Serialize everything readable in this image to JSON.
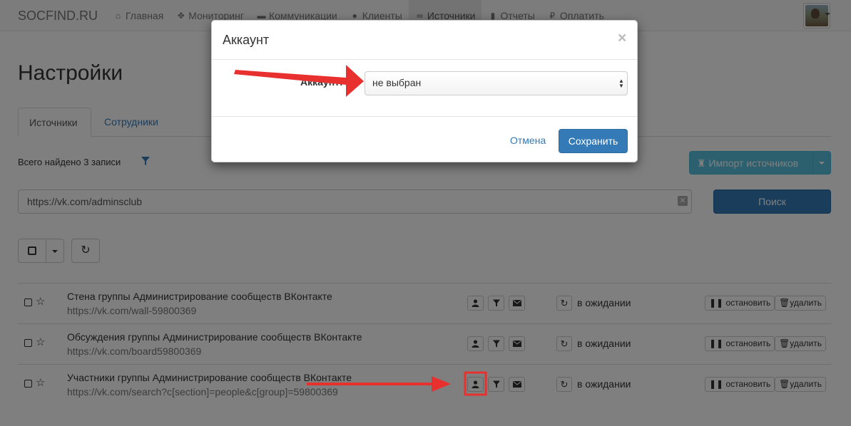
{
  "navbar": {
    "brand": "SOCFIND.RU",
    "items": [
      {
        "label": "Главная",
        "icon": "home-icon",
        "glyph": "⌂"
      },
      {
        "label": "Мониторинг",
        "icon": "move-icon",
        "glyph": "✥"
      },
      {
        "label": "Коммуникации",
        "icon": "comment-icon",
        "glyph": "▬"
      },
      {
        "label": "Клиенты",
        "icon": "user-icon",
        "glyph": "●"
      },
      {
        "label": "Источники",
        "icon": "link-icon",
        "glyph": "∞"
      },
      {
        "label": "Отчеты",
        "icon": "stats-icon",
        "glyph": "▮"
      },
      {
        "label": "Оплатить",
        "icon": "ruble-icon",
        "glyph": "₽"
      }
    ],
    "active_index": 4
  },
  "page": {
    "title": "Настройки"
  },
  "tabs": [
    {
      "label": "Источники"
    },
    {
      "label": "Сотрудники"
    }
  ],
  "found_text": "Всего найдено 3 записи",
  "import_button": "Импорт источников",
  "search": {
    "value": "https://vk.com/adminsclub",
    "button": "Поиск"
  },
  "rows": [
    {
      "title": "Стена группы Администрирование сообществ ВКонтакте",
      "url": "https://vk.com/wall-59800369",
      "status": "в ожидании",
      "stop": "остановить",
      "delete": "удалить"
    },
    {
      "title": "Обсуждения группы Администрирование сообществ ВКонтакте",
      "url": "https://vk.com/board59800369",
      "status": "в ожидании",
      "stop": "остановить",
      "delete": "удалить"
    },
    {
      "title": "Участники группы Администрирование сообществ ВКонтакте",
      "url": "https://vk.com/search?c[section]=people&c[group]=59800369",
      "status": "в ожидании",
      "stop": "остановить",
      "delete": "удалить"
    }
  ],
  "modal": {
    "title": "Аккаунт",
    "close": "×",
    "field_label": "Аккаунт:",
    "select_value": "не выбран",
    "cancel": "Отмена",
    "save": "Сохранить"
  },
  "colors": {
    "primary": "#337ab7",
    "info": "#5bc0de",
    "annotation": "#e8312f"
  }
}
